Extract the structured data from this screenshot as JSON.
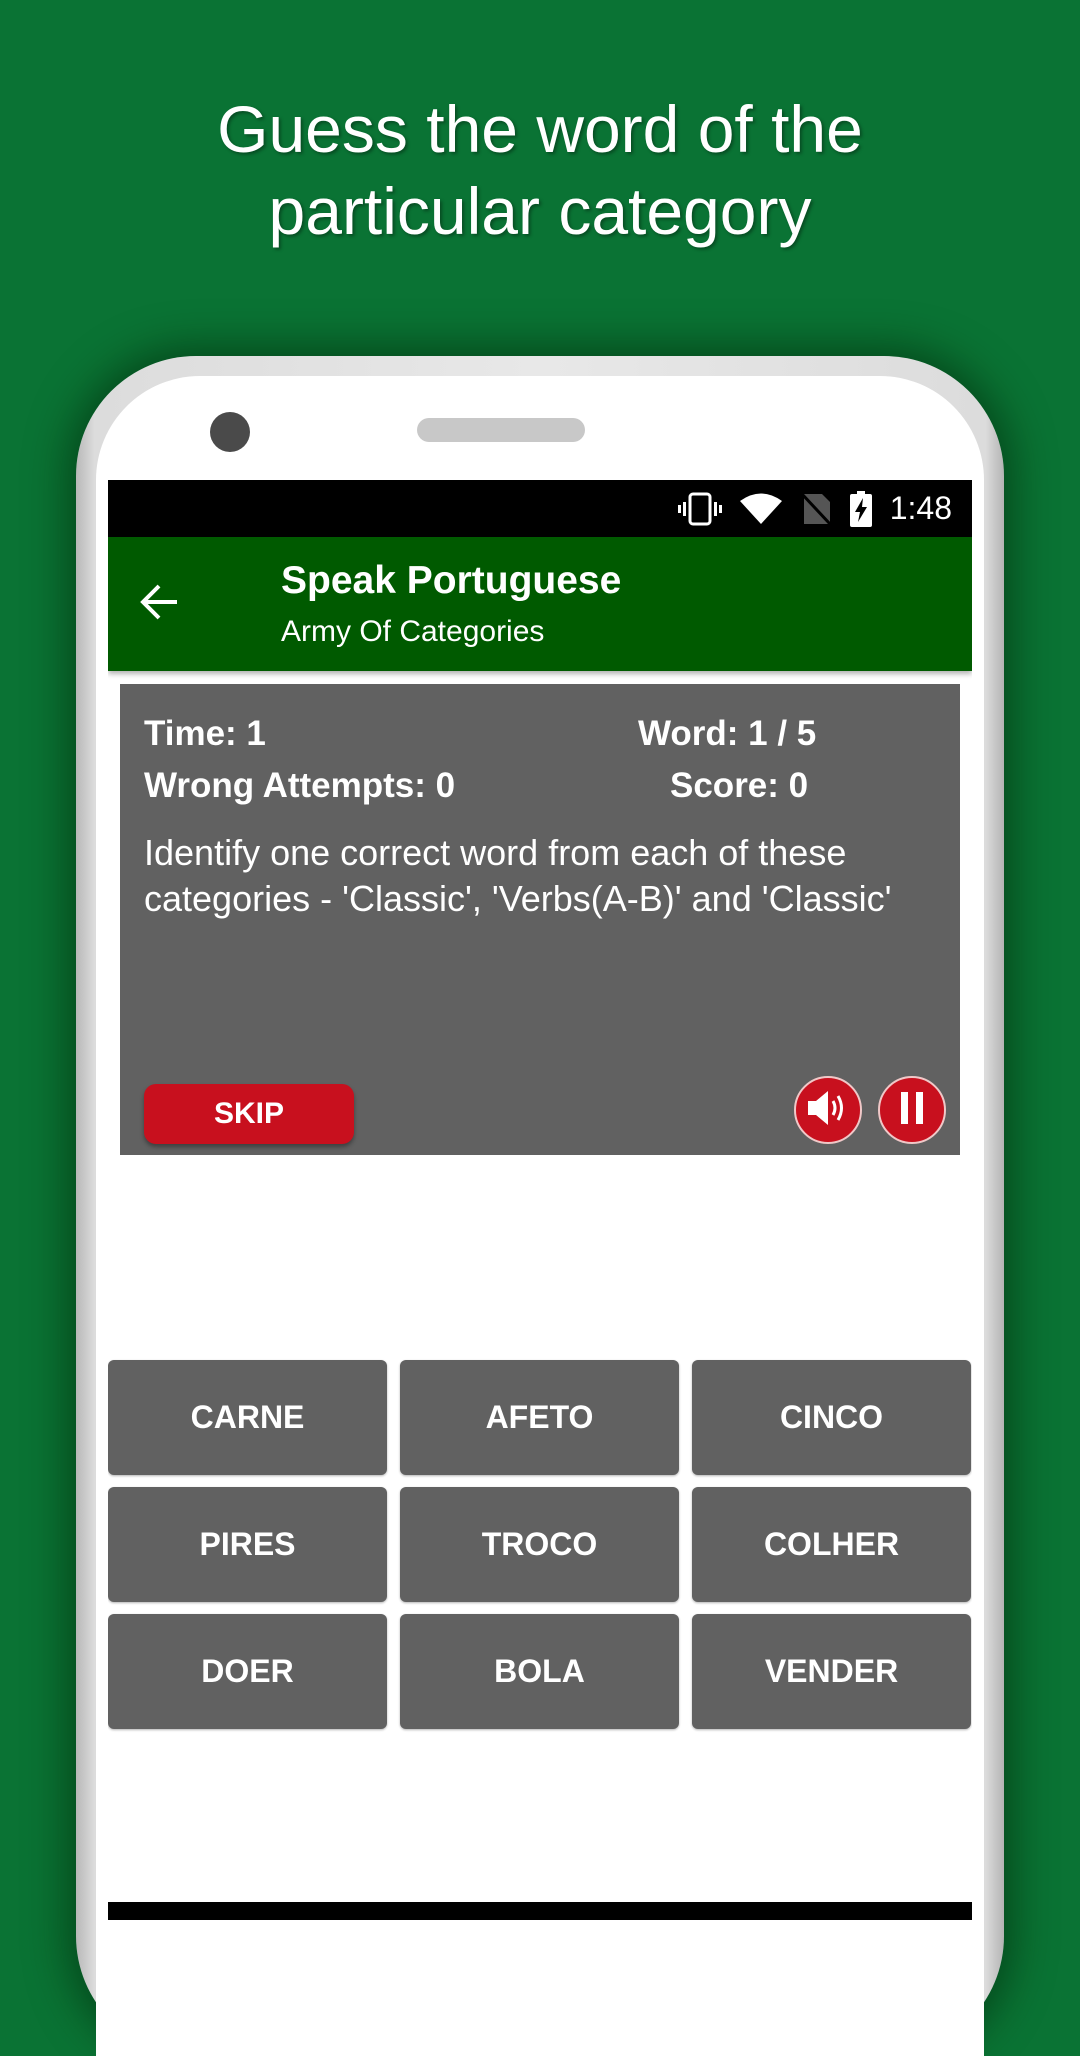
{
  "promo": {
    "line1": "Guess the word of the",
    "line2": "particular category"
  },
  "status_bar": {
    "icons": [
      "vibrate-icon",
      "wifi-icon",
      "no-sim-icon",
      "battery-charging-icon"
    ],
    "time": "1:48"
  },
  "app_bar": {
    "back_icon": "arrow-back-icon",
    "title": "Speak Portuguese",
    "subtitle": "Army Of Categories"
  },
  "game": {
    "time_label": "Time: 1",
    "word_label": "Word: 1 / 5",
    "wrong_label": "Wrong Attempts: 0",
    "score_label": "Score: 0",
    "instructions": "Identify one correct word from each of these categories - 'Classic', 'Verbs(A-B)' and 'Classic'",
    "skip_label": "SKIP",
    "sound_icon": "speaker-icon",
    "pause_icon": "pause-icon"
  },
  "colors": {
    "background": "#0a7334",
    "app_bar": "#005a00",
    "panel": "#616161",
    "accent_red": "#c8101e"
  },
  "words": [
    {
      "label": "CARNE"
    },
    {
      "label": "AFETO"
    },
    {
      "label": "CINCO"
    },
    {
      "label": "PIRES"
    },
    {
      "label": "TROCO"
    },
    {
      "label": "COLHER"
    },
    {
      "label": "DOER"
    },
    {
      "label": "BOLA"
    },
    {
      "label": "VENDER"
    }
  ]
}
